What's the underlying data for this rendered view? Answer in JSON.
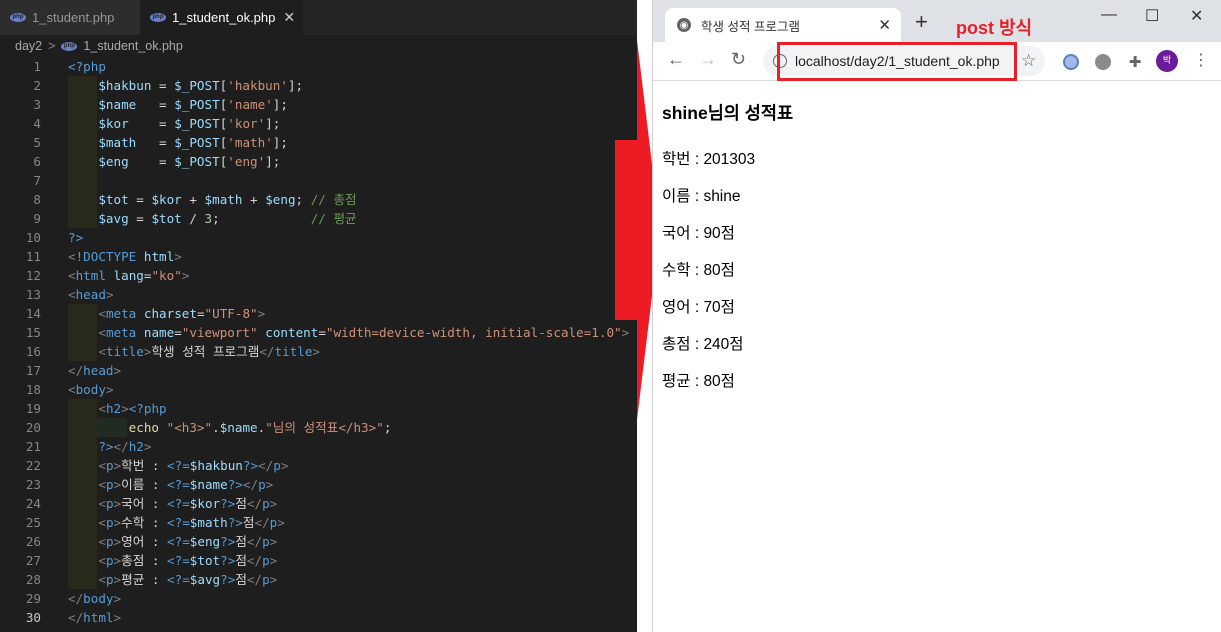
{
  "editor": {
    "tabs": [
      {
        "label": "1_student.php",
        "active": false
      },
      {
        "label": "1_student_ok.php",
        "active": true
      }
    ],
    "tab_close_glyph": "✕",
    "breadcrumb": {
      "folder": "day2",
      "separator": ">",
      "file": "1_student_ok.php"
    },
    "file_icon_text": "php",
    "line_numbers": [
      "1",
      "2",
      "3",
      "4",
      "5",
      "6",
      "7",
      "8",
      "9",
      "10",
      "11",
      "12",
      "13",
      "14",
      "15",
      "16",
      "17",
      "18",
      "19",
      "20",
      "21",
      "22",
      "23",
      "24",
      "25",
      "26",
      "27",
      "28",
      "29",
      "30"
    ],
    "current_line": "30"
  },
  "browser": {
    "tab_title": "학생 성적 프로그램",
    "tab_close": "✕",
    "new_tab": "+",
    "annotation_label": "post 방식",
    "window_controls": {
      "minimize": "—",
      "maximize": "☐",
      "close": "✕"
    },
    "nav": {
      "back": "←",
      "forward": "→",
      "reload": "↻"
    },
    "url": "localhost/day2/1_student_ok.php",
    "bookmark": "☆",
    "avatar_letter": "박",
    "menu": "⋮",
    "page": {
      "heading": "shine님의 성적표",
      "lines": [
        "학번 : 201303",
        "이름 : shine",
        "국어 : 90점",
        "수학 : 80점",
        "영어 : 70점",
        "총점 : 240점",
        "평균 : 80점"
      ]
    }
  },
  "colors": {
    "annotation_red": "#e8202a",
    "editor_bg": "#1e1e1e"
  }
}
